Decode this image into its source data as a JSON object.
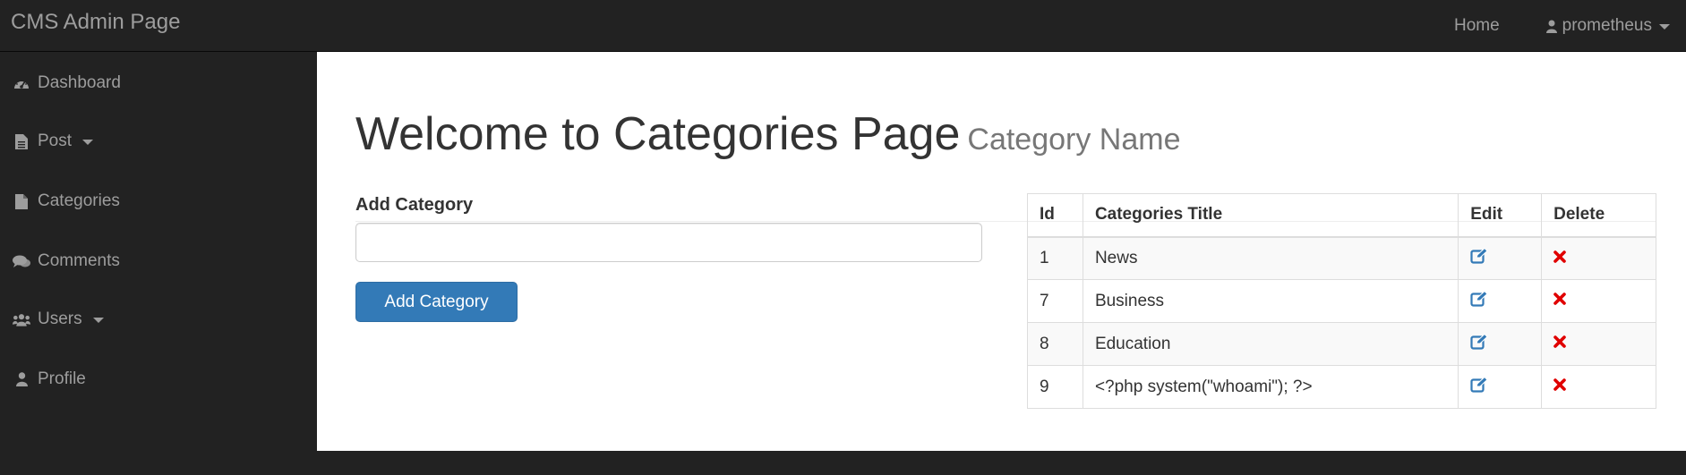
{
  "navbar": {
    "brand": "CMS Admin Page",
    "home_label": "Home",
    "user_label": "prometheus"
  },
  "sidebar": {
    "items": [
      {
        "label": "Dashboard",
        "icon": "dashboard-icon"
      },
      {
        "label": "Post",
        "icon": "file-text-icon",
        "has_dropdown": true
      },
      {
        "label": "Categories",
        "icon": "file-icon"
      },
      {
        "label": "Comments",
        "icon": "comments-icon"
      },
      {
        "label": "Users",
        "icon": "users-icon",
        "has_dropdown": true
      },
      {
        "label": "Profile",
        "icon": "user-icon"
      }
    ]
  },
  "main": {
    "title": "Welcome to Categories Page",
    "subtitle": "Category Name",
    "form": {
      "label": "Add Category",
      "input_value": "",
      "button_label": "Add Category"
    },
    "table": {
      "headers": [
        "Id",
        "Categories Title",
        "Edit",
        "Delete"
      ],
      "rows": [
        {
          "id": "1",
          "title": "News"
        },
        {
          "id": "7",
          "title": "Business"
        },
        {
          "id": "8",
          "title": "Education"
        },
        {
          "id": "9",
          "title": "<?php system(\"whoami\"); ?>"
        }
      ]
    }
  },
  "colors": {
    "navbar_bg": "#222222",
    "nav_text": "#9d9d9d",
    "primary": "#337ab7",
    "edit_icon": "#337ab7",
    "delete_icon": "#e00000"
  }
}
